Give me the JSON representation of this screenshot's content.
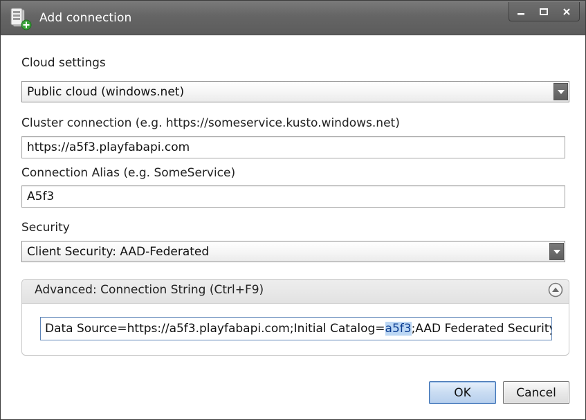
{
  "window": {
    "title": "Add connection",
    "controls": [
      "minimize",
      "maximize",
      "close"
    ]
  },
  "cloud_settings": {
    "label": "Cloud settings",
    "selected": "Public cloud (windows.net)"
  },
  "cluster_connection": {
    "label": "Cluster connection (e.g. https://someservice.kusto.windows.net)",
    "value": "https://a5f3.playfabapi.com"
  },
  "connection_alias": {
    "label": "Connection Alias (e.g. SomeService)",
    "value": "A5f3"
  },
  "security": {
    "label": "Security",
    "selected": "Client Security: AAD-Federated"
  },
  "advanced": {
    "header": "Advanced: Connection String (Ctrl+F9)",
    "connection_string_before": "Data Source=https://a5f3.playfabapi.com;Initial Catalog=",
    "connection_string_selected": "a5f3",
    "connection_string_after": ";AAD Federated Security=True"
  },
  "buttons": {
    "ok": "OK",
    "cancel": "Cancel"
  },
  "colors": {
    "titlebar": "#666666",
    "selection": "#bcd7f4",
    "ok_border": "#3e71b3"
  },
  "icons": [
    "add-connection-app-icon",
    "minimize-icon",
    "maximize-icon",
    "close-icon",
    "chevron-down-icon",
    "collapse-up-icon"
  ]
}
